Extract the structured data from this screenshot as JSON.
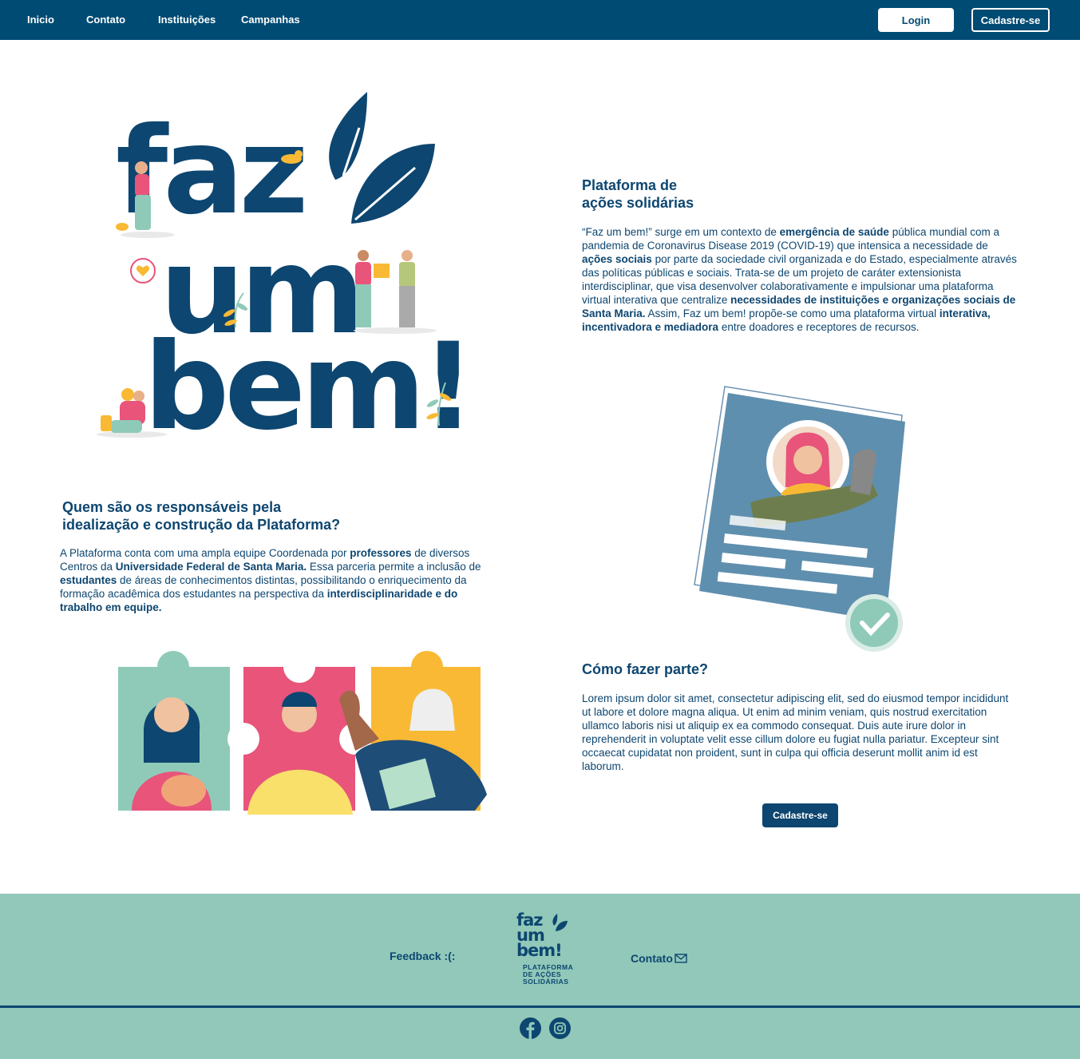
{
  "nav": {
    "links": [
      "Inicio",
      "Contato",
      "Instituições",
      "Campanhas"
    ],
    "login": "Login",
    "signup": "Cadastre-se"
  },
  "hero": {
    "logo_line1": "faz",
    "logo_line2": "um",
    "logo_line3": "bem!"
  },
  "about": {
    "title_line1": "Plataforma de",
    "title_line2": "ações solidárias",
    "p1": "“Faz um bem!” surge em um contexto de ",
    "b1": "emergência de saúde",
    "p2": " pública mundial com a pandemia de Coronavirus Disease 2019 (COVID-19) que intensica a necessidade de ",
    "b2": "ações sociais",
    "p3": " por parte da sociedade civil organizada e do Estado, especialmente através das políticas públicas e sociais. Trata-se de um projeto de caráter extensionista interdisciplinar, que visa desenvolver colaborativamente e impulsionar uma plataforma virtual interativa que centralize ",
    "b3": "necessidades de instituições e organizações sociais de Santa Maria.",
    "p4": " Assim, Faz um bem! propõe-se como uma plataforma virtual ",
    "b4": "interativa, incentivadora e mediadora",
    "p5": " entre doadores e receptores de recursos."
  },
  "team": {
    "title_line1": "Quem são os responsáveis pela",
    "title_line2": "idealização e construção da Plataforma?",
    "p1": "A Plataforma conta com uma ampla equipe Coordenada por ",
    "b1": "professores",
    "p2": " de diversos Centros da ",
    "b2": "Universidade Federal de Santa Maria.",
    "p3": " Essa parceria permite a inclusão de ",
    "b3": "estudantes",
    "p4": " de áreas de conhecimentos distintas, possibilitando o enriquecimento da formação acadêmica dos estudantes na perspectiva da ",
    "b4": "interdisciplinaridade e do trabalho em equipe."
  },
  "join": {
    "title": "Cómo fazer parte?",
    "text": "Lorem ipsum dolor sit amet, consectetur adipiscing elit, sed do eiusmod tempor incididunt ut labore et dolore magna aliqua. Ut enim ad minim veniam, quis nostrud exercitation ullamco laboris nisi ut aliquip ex ea commodo consequat. Duis aute irure dolor in reprehenderit in voluptate velit esse cillum dolore eu fugiat nulla pariatur. Excepteur sint occaecat cupidatat non proident, sunt in culpa qui officia deserunt mollit anim id est laborum.",
    "button": "Cadastre-se"
  },
  "footer": {
    "feedback": "Feedback :(:",
    "contato": "Contato",
    "logo_line1": "faz",
    "logo_line2": "um",
    "logo_line3": "bem!",
    "logo_sub1": "PLATAFORMA",
    "logo_sub2": "DE AÇÕES",
    "logo_sub3": "SOLIDÁRIAS"
  },
  "colors": {
    "primary": "#0d4670",
    "nav": "#004b73",
    "footer": "#91c8b9",
    "teal": "#8fcab9",
    "pink": "#e8547a",
    "yellow": "#f9b934"
  },
  "icons": [
    "leaf-icon",
    "heart-chat-icon",
    "check-icon",
    "mail-icon",
    "facebook-icon",
    "instagram-icon"
  ]
}
